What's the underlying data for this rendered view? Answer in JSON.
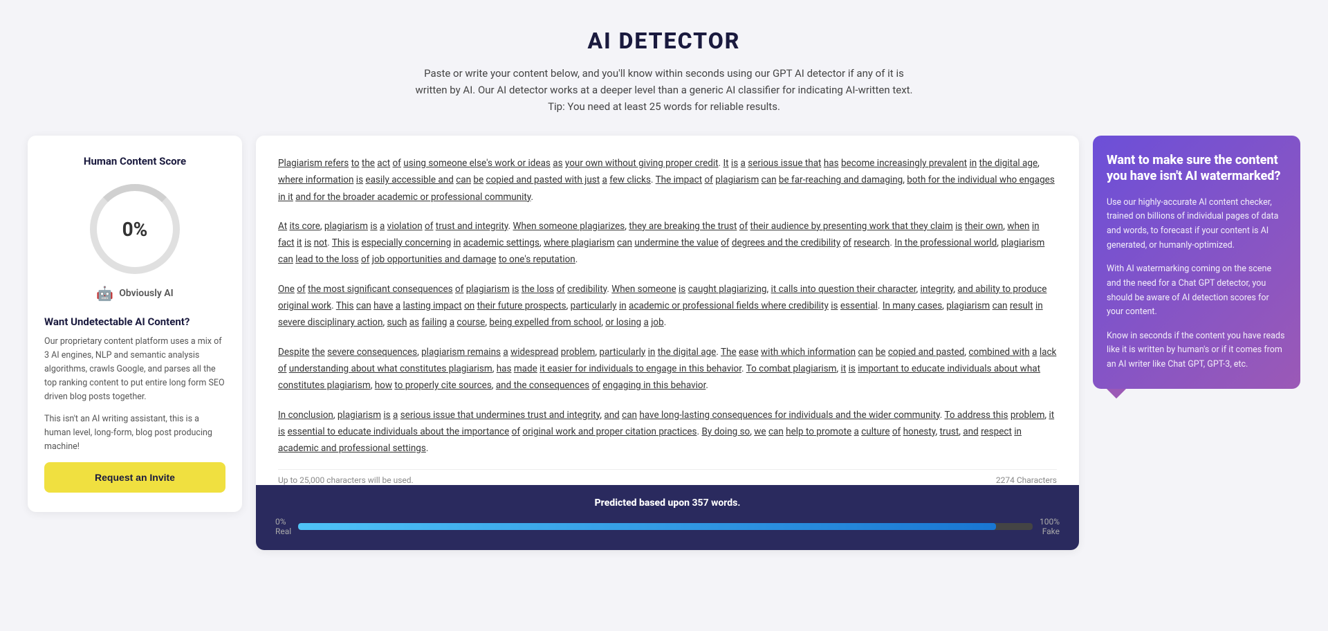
{
  "header": {
    "title": "AI DETECTOR",
    "description": "Paste or write your content below, and you'll know within seconds using our GPT AI detector if any of it is written by AI. Our AI detector works at a deeper level than a generic AI classifier for indicating AI-written text. Tip: You need at least 25 words for reliable results."
  },
  "left_panel": {
    "title": "Human Content Score",
    "score": "0%",
    "ai_label": "Obviously AI",
    "want_title": "Want Undetectable AI Content?",
    "desc1": "Our proprietary content platform uses a mix of 3 AI engines, NLP and semantic analysis algorithms, crawls Google, and parses all the top ranking content to put entire long form SEO driven blog posts together.",
    "desc2": "This isn't an AI writing assistant, this is a human level, long-form, blog post producing machine!",
    "btn_label": "Request an Invite"
  },
  "content": {
    "paragraphs": [
      "Plagiarism refers to the act of using someone else's work or ideas as your own without giving proper credit. It is a serious issue that has become increasingly prevalent in the digital age, where information is easily accessible and can be copied and pasted with just a few clicks. The impact of plagiarism can be far-reaching and damaging, both for the individual who engages in it and for the broader academic or professional community.",
      "At its core, plagiarism is a violation of trust and integrity. When someone plagiarizes, they are breaking the trust of their audience by presenting work that they claim is their own, when in fact it is not. This is especially concerning in academic settings, where plagiarism can undermine the value of degrees and the credibility of research. In the professional world, plagiarism can lead to the loss of job opportunities and damage to one's reputation.",
      "One of the most significant consequences of plagiarism is the loss of credibility. When someone is caught plagiarizing, it calls into question their character, integrity, and ability to produce original work. This can have a lasting impact on their future prospects, particularly in academic or professional fields where credibility is essential. In many cases, plagiarism can result in severe disciplinary action, such as failing a course, being expelled from school, or losing a job.",
      "Despite the severe consequences, plagiarism remains a widespread problem, particularly in the digital age. The ease with which information can be copied and pasted, combined with a lack of understanding about what constitutes plagiarism, has made it easier for individuals to engage in this behavior. To combat plagiarism, it is important to educate individuals about what constitutes plagiarism, how to properly cite sources, and the consequences of engaging in this behavior.",
      "In conclusion, plagiarism is a serious issue that undermines trust and integrity, and can have long-lasting consequences for individuals and the wider community. To address this problem, it is essential to educate individuals about the importance of original work and proper citation practices. By doing so, we can help to promote a culture of honesty, trust, and respect in academic and professional settings."
    ],
    "footer_left": "Up to 25,000 characters will be used.",
    "footer_right": "2274 Characters",
    "progress": {
      "label": "Predicted based upon",
      "words": "357 words.",
      "left_pct": "0%",
      "left_label": "Real",
      "right_pct": "100%",
      "right_label": "Fake",
      "fill_percent": 95
    }
  },
  "right_panel": {
    "watermark_title": "Want to make sure the content you have isn't AI watermarked?",
    "para1": "Use our highly-accurate AI content checker, trained on billions of individual pages of data and words, to forecast if your content is AI generated, or humanly-optimized.",
    "para2": "With AI watermarking coming on the scene and the need for a Chat GPT detector, you should be aware of AI detection scores for your content.",
    "para3": "Know in seconds if the content you have reads like it is written by human's or if it comes from an AI writer like Chat GPT, GPT-3, etc."
  }
}
